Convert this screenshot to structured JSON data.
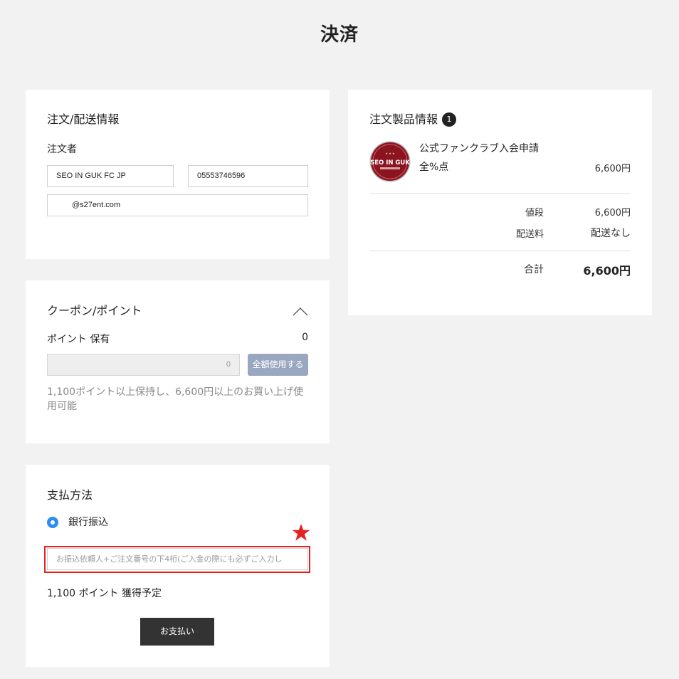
{
  "page": {
    "title": "決済"
  },
  "order_info": {
    "title": "注文/配送情報",
    "orderer_label": "注文者",
    "name_value": "SEO IN GUK FC JP",
    "phone_value": "05553746596",
    "email_value": "@s27ent.com"
  },
  "coupon": {
    "title": "クーポン/ポイント",
    "points_label": "ポイント 保有",
    "points_balance": "0",
    "points_input_value": "0",
    "use_all_label": "全額使用する",
    "note": "1,100ポイント以上保持し、6,600円以上のお買い上げ使用可能"
  },
  "payment": {
    "title": "支払方法",
    "method_label": "銀行振込",
    "depositor_placeholder": "お振込依頼人+ご注文番号の下4桁(ご入金の際にも必ずご入力し",
    "earn_points": "1,100 ポイント 獲得予定",
    "pay_button_label": "お支払い"
  },
  "product": {
    "title": "注文製品情報",
    "count": "1",
    "thumb_text": "SEO IN GUK",
    "name": "公式ファンクラブ入会申請",
    "options": "全%点",
    "price": "6,600円",
    "summary": {
      "price_label": "値段",
      "price_value": "6,600円",
      "shipping_label": "配送料",
      "shipping_value": "配送なし",
      "total_label": "合計",
      "total_value": "6,600円"
    }
  },
  "colors": {
    "accent_blue": "#2d8cf0",
    "use_all_button": "#9aa7c1",
    "pay_button": "#333333",
    "highlight_red": "#e52222",
    "thumb_red": "#8c1420"
  },
  "icons": {
    "collapse": "chevron-up-icon",
    "highlight": "star-icon",
    "radio": "radio-selected-icon"
  }
}
